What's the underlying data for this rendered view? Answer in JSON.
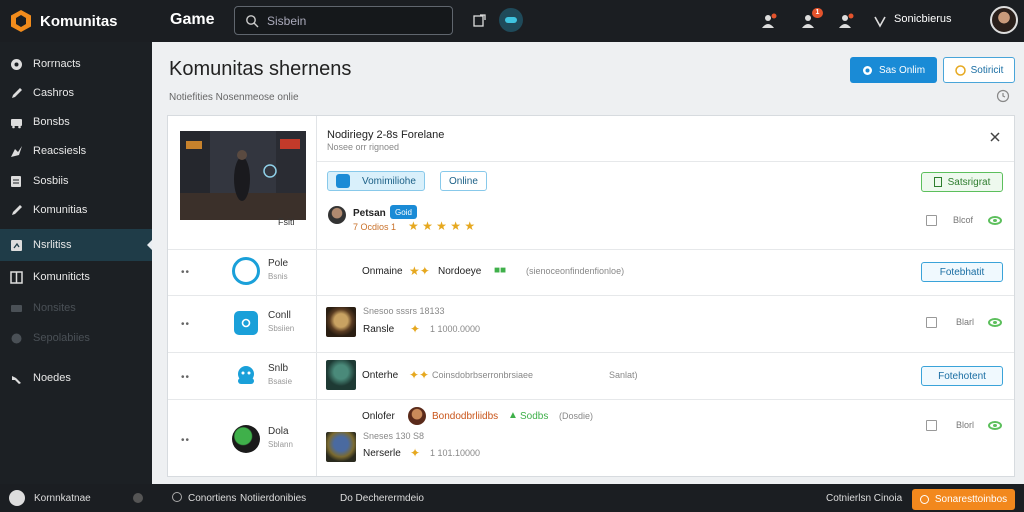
{
  "app": {
    "name": "Komunitas",
    "section": "Game"
  },
  "search": {
    "placeholder": "Sisbein"
  },
  "topbar": {
    "notif_badge": "1",
    "user_label": "Sonicbierus"
  },
  "sidebar": {
    "items": [
      {
        "label": "Rorrnacts",
        "icon": "gamepad-icon"
      },
      {
        "label": "Cashros",
        "icon": "pencil-icon"
      },
      {
        "label": "Bonsbs",
        "icon": "bus-icon"
      },
      {
        "label": "Reacsiesls",
        "icon": "puzzle-icon"
      },
      {
        "label": "Sosbiis",
        "icon": "document-icon"
      },
      {
        "label": "Komunitias",
        "icon": "pencil-icon"
      },
      {
        "label": "Nsrlitiss",
        "icon": "window-icon"
      },
      {
        "label": "Komuniticts",
        "icon": "grid-icon"
      },
      {
        "label": "Nonsites",
        "icon": "bus-icon"
      },
      {
        "label": "Sepolabiies",
        "icon": "gear-icon"
      },
      {
        "label": "Noedes",
        "icon": "wrench-icon"
      }
    ]
  },
  "main": {
    "title": "Komunitas shernens",
    "subtitle": "Notiefities Nosenmeose onlie",
    "btn_primary": "Sas Onlim",
    "btn_secondary": "Sotiricit"
  },
  "detail": {
    "title": "Nodiriegy 2-8s Forelane",
    "subtitle": "Nosee orr rignoed",
    "chip_blue": "Vomimiliohe",
    "chip_online": "Online",
    "tag_green": "Satsrigrat",
    "player_name": "Petsan",
    "player_badge": "Goid",
    "player_meta": "7 Ocdios 1",
    "player_stat": "Blcof"
  },
  "thumb": {
    "caption": "Fsiti"
  },
  "contacts": [
    {
      "name": "Pole",
      "sub": "Bsnis"
    },
    {
      "name": "Conll",
      "sub": "Sbsiien"
    },
    {
      "name": "Snlb",
      "sub": "Bsasie"
    },
    {
      "name": "Dola",
      "sub": "Sblann"
    }
  ],
  "rows": [
    {
      "prefix": "Onmaine",
      "name": "Nordoeye",
      "desc": "(sienoceonfindenfionloe)",
      "tag": "Fotebhatit"
    },
    {
      "line1": "Snesoo sssrs 18133",
      "line2a": "Ransle",
      "line2b": "1 1000.0000",
      "stat": "Blarl"
    },
    {
      "prefix": "Onterhe",
      "desc": "Coinsdobrbserronbrsiaee",
      "suffix": "Sanlat)",
      "tag": "Fotehotent"
    },
    {
      "prefix": "Onlofer",
      "name": "Bondodbrliidbs",
      "green": "Sodbs",
      "desc": "(Dosdie)",
      "line1": "Sneses 130 S8",
      "line2a": "Nerserle",
      "line2b": "1 101.10000",
      "stat": "Blorl"
    }
  ],
  "footer": {
    "left": "Kornnkatnae",
    "mid1": "Conortiens",
    "mid2": "Notiierdonibies",
    "mid3": "Do Decherermdeio",
    "right_label": "Cotnierlsn Cinoia",
    "cta": "Sonaresttoinbos"
  },
  "colors": {
    "accent": "#1a8bd6",
    "cta": "#f2881d",
    "success": "#5cbf5c",
    "sidebar": "#1c2024"
  }
}
